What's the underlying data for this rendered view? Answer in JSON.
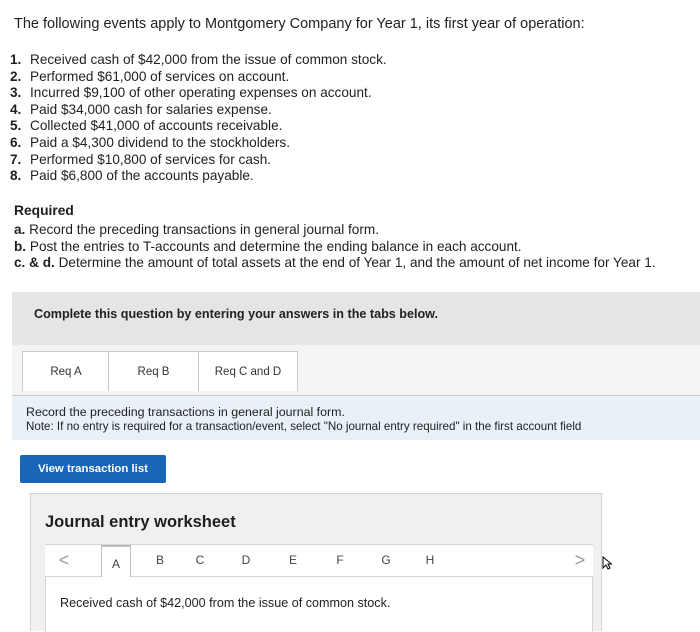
{
  "intro": "The following events apply to Montgomery Company for Year 1, its first year of operation:",
  "events": [
    {
      "num": "1.",
      "text": "Received cash of $42,000 from the issue of common stock."
    },
    {
      "num": "2.",
      "text": "Performed $61,000 of services on account."
    },
    {
      "num": "3.",
      "text": "Incurred $9,100 of other operating expenses on account."
    },
    {
      "num": "4.",
      "text": "Paid $34,000 cash for salaries expense."
    },
    {
      "num": "5.",
      "text": "Collected $41,000 of accounts receivable."
    },
    {
      "num": "6.",
      "text": "Paid a $4,300 dividend to the stockholders."
    },
    {
      "num": "7.",
      "text": "Performed $10,800 of services for cash."
    },
    {
      "num": "8.",
      "text": "Paid $6,800 of the accounts payable."
    }
  ],
  "required": {
    "title": "Required",
    "items": [
      {
        "label": "a.",
        "text": "Record the preceding transactions in general journal form."
      },
      {
        "label": "b.",
        "text": "Post the entries to T-accounts and determine the ending balance in each account."
      },
      {
        "label": "c. & d.",
        "text": "Determine the amount of total assets at the end of Year 1, and the amount of net income for Year 1."
      }
    ]
  },
  "complete_prompt": "Complete this question by entering your answers in the tabs below.",
  "tabs": [
    {
      "label": "Req A"
    },
    {
      "label": "Req B"
    },
    {
      "label": "Req C and D"
    }
  ],
  "instructions": {
    "line1": "Record the preceding transactions in general journal form.",
    "line2": "Note: If no entry is required for a transaction/event, select \"No journal entry required\" in the first account field"
  },
  "view_button": "View transaction list",
  "worksheet": {
    "title": "Journal entry worksheet",
    "prev": "<",
    "next": ">",
    "letters": [
      "A",
      "B",
      "C",
      "D",
      "E",
      "F",
      "G",
      "H"
    ],
    "active_letter": "A",
    "description": "Received cash of $42,000 from the issue of common stock."
  },
  "colors": {
    "button_blue": "#1b65b8",
    "band_gray": "#e5e5e5",
    "instr_blue": "#e8f0f8"
  }
}
